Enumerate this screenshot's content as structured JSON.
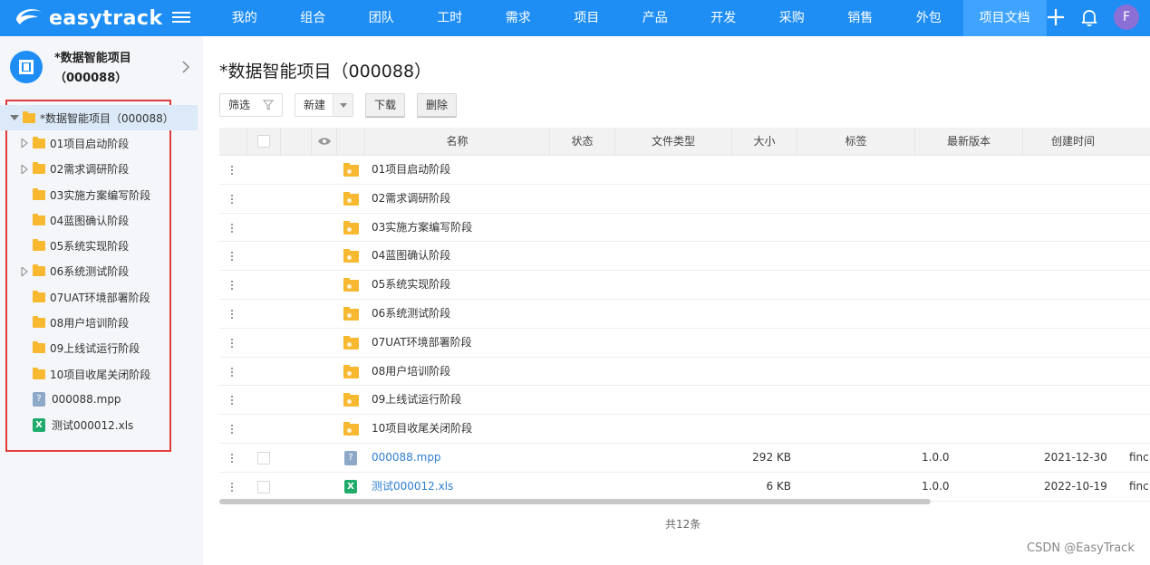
{
  "app": {
    "name": "easytrack"
  },
  "nav": {
    "items": [
      "我的",
      "组合",
      "团队",
      "工时",
      "需求",
      "项目",
      "产品",
      "开发",
      "采购",
      "销售",
      "外包",
      "项目文档"
    ],
    "active": "项目文档",
    "avatar": "F"
  },
  "sidebar": {
    "project_title": "*数据智能项目（000088）",
    "tree": [
      {
        "label": "*数据智能项目（000088）",
        "type": "folder",
        "expanded": true,
        "level": 0
      },
      {
        "label": "01项目启动阶段",
        "type": "folder",
        "expandable": true,
        "level": 1
      },
      {
        "label": "02需求调研阶段",
        "type": "folder",
        "expandable": true,
        "level": 1
      },
      {
        "label": "03实施方案编写阶段",
        "type": "folder",
        "expandable": false,
        "level": 1
      },
      {
        "label": "04蓝图确认阶段",
        "type": "folder",
        "expandable": false,
        "level": 1
      },
      {
        "label": "05系统实现阶段",
        "type": "folder",
        "expandable": false,
        "level": 1
      },
      {
        "label": "06系统测试阶段",
        "type": "folder",
        "expandable": true,
        "level": 1
      },
      {
        "label": "07UAT环境部署阶段",
        "type": "folder",
        "expandable": false,
        "level": 1
      },
      {
        "label": "08用户培训阶段",
        "type": "folder",
        "expandable": false,
        "level": 1
      },
      {
        "label": "09上线试运行阶段",
        "type": "folder",
        "expandable": false,
        "level": 1
      },
      {
        "label": "10项目收尾关闭阶段",
        "type": "folder",
        "expandable": false,
        "level": 1
      },
      {
        "label": "000088.mpp",
        "type": "mpp",
        "level": 1
      },
      {
        "label": "测试000012.xls",
        "type": "xls",
        "level": 1
      }
    ]
  },
  "main": {
    "title": "*数据智能项目（000088）",
    "toolbar": {
      "filter": "筛选",
      "new": "新建",
      "download": "下载",
      "delete": "删除"
    },
    "columns": [
      "名称",
      "状态",
      "文件类型",
      "大小",
      "标签",
      "最新版本",
      "创建时间"
    ],
    "rows": [
      {
        "name": "01项目启动阶段",
        "type": "folder"
      },
      {
        "name": "02需求调研阶段",
        "type": "folder"
      },
      {
        "name": "03实施方案编写阶段",
        "type": "folder"
      },
      {
        "name": "04蓝图确认阶段",
        "type": "folder"
      },
      {
        "name": "05系统实现阶段",
        "type": "folder"
      },
      {
        "name": "06系统测试阶段",
        "type": "folder"
      },
      {
        "name": "07UAT环境部署阶段",
        "type": "folder"
      },
      {
        "name": "08用户培训阶段",
        "type": "folder"
      },
      {
        "name": "09上线试运行阶段",
        "type": "folder"
      },
      {
        "name": "10项目收尾关闭阶段",
        "type": "folder"
      },
      {
        "name": "000088.mpp",
        "type": "mpp",
        "size": "292 KB",
        "version": "1.0.0",
        "created": "2021-12-30",
        "extra": "finc"
      },
      {
        "name": "测试000012.xls",
        "type": "xls",
        "size": "6 KB",
        "version": "1.0.0",
        "created": "2022-10-19",
        "extra": "finc"
      }
    ],
    "total": "共12条"
  },
  "watermark": "CSDN @EasyTrack",
  "colors": {
    "primary": "#1e8ef5",
    "active_nav": "#3ea4ff",
    "highlight_box": "#e23b3b",
    "folder": "#f8b830"
  }
}
